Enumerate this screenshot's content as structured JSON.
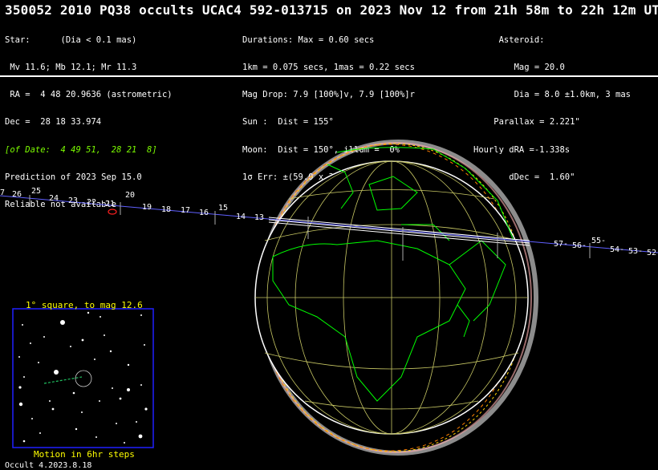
{
  "title": "350052 2010 PQ38 occults UCAC4 592-013715 on 2023 Nov 12 from 21h 58m to 22h 12m UT",
  "star": {
    "lines": [
      "Star:      (Dia < 0.1 mas)",
      " Mv 11.6; Mb 12.1; Mr 11.3",
      " RA =  4 48 20.9636 (astrometric)",
      "Dec =  28 18 33.974",
      "[of Date:  4 49 51,  28 21  8]",
      "Prediction of 2023 Sep 15.0",
      "Reliable not available"
    ]
  },
  "event": {
    "lines": [
      "Durations: Max = 0.60 secs",
      "1km = 0.075 secs, 1mas = 0.22 secs",
      "Mag Drop: 7.9 [100%]v, 7.9 [100%]r",
      "Sun :  Dist = 155°",
      "Moon:  Dist = 150°, illum =  0%",
      "1σ Err: ±(59.0 x 31.0) mas in PA 76°"
    ]
  },
  "asteroid": {
    "lines": [
      "     Asteroid:",
      "        Mag = 20.0",
      "        Dia = 8.0 ±1.0km, 3 mas",
      "    Parallax = 2.221\"",
      "Hourly dRA =-1.338s",
      "       dDec =  1.60\""
    ]
  },
  "track_ticks_left": [
    "7",
    "26",
    "25",
    "24",
    "23",
    "22",
    "21",
    "20",
    "19",
    "18",
    "17",
    "16",
    "15",
    "14",
    "13"
  ],
  "track_ticks_right": [
    "57-",
    "56-",
    "55-",
    "54-",
    "53-",
    "52"
  ],
  "inset": {
    "title": "1° square, to mag 12.6",
    "footer": "Motion in 6hr steps"
  },
  "footer": "Occult 4.2023.8.18",
  "colors": {
    "background": "#000000",
    "text": "#ffffff",
    "coastline": "#00ff00",
    "graticule": "#c8c864",
    "inset_border": "#0000ff",
    "inset_label": "#ffff00",
    "track": "#6060ff"
  }
}
